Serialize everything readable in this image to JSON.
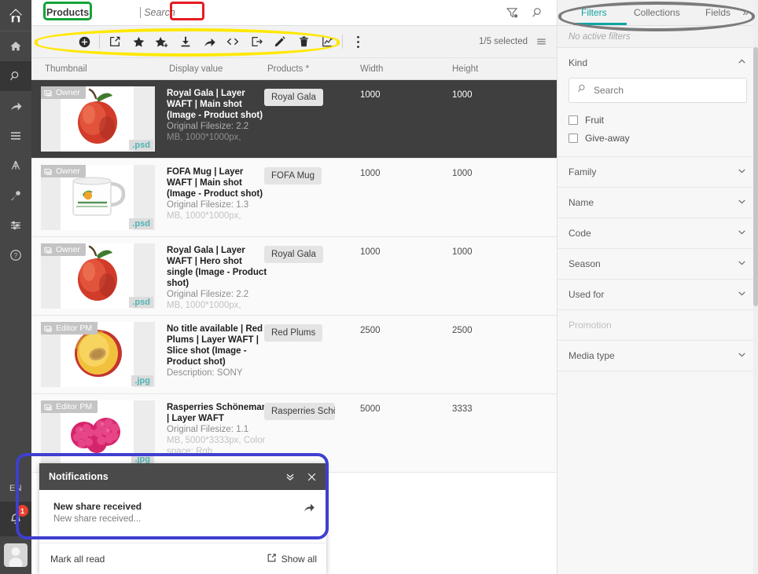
{
  "rail": {
    "logo": "app-logo",
    "items": [
      {
        "name": "home",
        "icon": "home-icon",
        "active": false
      },
      {
        "name": "search",
        "icon": "search-icon",
        "active": true
      },
      {
        "name": "share",
        "icon": "share-arrow-icon",
        "active": false
      },
      {
        "name": "lists",
        "icon": "list-icon",
        "active": false
      },
      {
        "name": "hierarchy",
        "icon": "hierarchy-icon",
        "active": false
      },
      {
        "name": "permissions",
        "icon": "key-icon",
        "active": false
      },
      {
        "name": "settings",
        "icon": "sliders-icon",
        "active": false
      },
      {
        "name": "help",
        "icon": "help-circle-icon",
        "active": false
      }
    ],
    "language": "EN",
    "notification_count": "1"
  },
  "topbar": {
    "breadcrumb": "Products",
    "search_placeholder": "Search",
    "search_value": "",
    "filter_icon": "filter-settings-icon",
    "search_icon": "search-icon"
  },
  "toolbar": {
    "actions": [
      {
        "name": "add",
        "icon": "plus-circle-icon"
      },
      {
        "name": "open-external",
        "icon": "external-link-icon"
      },
      {
        "name": "favorite",
        "icon": "star-icon"
      },
      {
        "name": "add-to-favorites",
        "icon": "star-plus-icon"
      },
      {
        "name": "download",
        "icon": "download-icon"
      },
      {
        "name": "share",
        "icon": "share-arrow-icon"
      },
      {
        "name": "embed-code",
        "icon": "code-brackets-icon"
      },
      {
        "name": "export",
        "icon": "export-box-arrow-icon"
      },
      {
        "name": "edit",
        "icon": "pencil-icon"
      },
      {
        "name": "delete",
        "icon": "trash-icon"
      },
      {
        "name": "statistics",
        "icon": "line-chart-icon"
      },
      {
        "name": "more",
        "icon": "more-vertical-icon"
      }
    ],
    "selected_label": "1/5 selected",
    "view_icon": "list-view-icon"
  },
  "table": {
    "columns": [
      "Thumbnail",
      "Display value",
      "Products *",
      "Width",
      "Height"
    ],
    "rows": [
      {
        "selected": true,
        "badge": "Owner",
        "filetype": ".psd",
        "art": "apple",
        "title": "Royal Gala | Layer WAFT | Main shot (Image - Product shot)",
        "sub": "Original Filesize: 2.2",
        "sub2": "MB, 1000*1000px,",
        "product": "Royal Gala",
        "width": "1000",
        "height": "1000"
      },
      {
        "selected": false,
        "badge": "Owner",
        "filetype": ".psd",
        "art": "mug",
        "title": "FOFA Mug | Layer WAFT | Main shot (Image - Product shot)",
        "sub": "Original Filesize: 1.3",
        "sub2": "MB, 1000*1000px,",
        "product": "FOFA Mug",
        "width": "1000",
        "height": "1000"
      },
      {
        "selected": false,
        "badge": "Owner",
        "filetype": ".psd",
        "art": "apple",
        "title": "Royal Gala | Layer WAFT | Hero shot single (Image - Product shot)",
        "sub": "Original Filesize: 2.2",
        "sub2": "MB, 1000*1000px,",
        "product": "Royal Gala",
        "width": "1000",
        "height": "1000"
      },
      {
        "selected": false,
        "badge": "Editor PM",
        "filetype": ".jpg",
        "art": "plum",
        "title": "No title available | Red Plums | Layer WAFT | Slice shot (Image - Product shot)",
        "sub": "Description: SONY",
        "sub2": "",
        "product": "Red Plums",
        "width": "2500",
        "height": "2500"
      },
      {
        "selected": false,
        "badge": "Editor PM",
        "filetype": ".jpg",
        "art": "raspberry",
        "title": "Rasperries Schöneman | Layer WAFT",
        "sub": "Original Filesize: 1.1",
        "sub2": "MB, 5000*3333px, Color space: Rgb",
        "product": "Rasperries Schöneman",
        "width": "5000",
        "height": "3333"
      }
    ]
  },
  "rightpanel": {
    "tabs": [
      {
        "label": "Filters",
        "active": true
      },
      {
        "label": "Collections",
        "active": false
      },
      {
        "label": "Fields",
        "active": false
      }
    ],
    "expand_icon": "chevron-double-right-icon",
    "no_active_filters": "No active filters",
    "groups": [
      {
        "label": "Kind",
        "expanded": true,
        "disabled": false,
        "search_placeholder": "Search",
        "options": [
          {
            "label": "Fruit",
            "checked": false
          },
          {
            "label": "Give-away",
            "checked": false
          }
        ]
      },
      {
        "label": "Family",
        "expanded": false,
        "disabled": false
      },
      {
        "label": "Name",
        "expanded": false,
        "disabled": false
      },
      {
        "label": "Code",
        "expanded": false,
        "disabled": false
      },
      {
        "label": "Season",
        "expanded": false,
        "disabled": false
      },
      {
        "label": "Used for",
        "expanded": false,
        "disabled": false
      },
      {
        "label": "Promotion",
        "expanded": false,
        "disabled": true
      },
      {
        "label": "Media type",
        "expanded": false,
        "disabled": false
      }
    ]
  },
  "notifications": {
    "title": "Notifications",
    "collapse_icon": "chevron-double-down-icon",
    "close_icon": "close-icon",
    "items": [
      {
        "title": "New share received",
        "subtitle": "New share received...",
        "action_icon": "share-arrow-icon"
      }
    ],
    "mark_all_read": "Mark all read",
    "show_all": "Show all",
    "show_all_icon": "external-link-icon"
  },
  "annotations": {
    "green": "#13a438",
    "red": "#e61b23",
    "yellow": "#ffe800",
    "grey": "#7b7b7b",
    "blue": "#3f3fd0"
  },
  "colors": {
    "accent_teal": "#12a3a3",
    "selected_row": "#3f3f3f",
    "rail_bg": "#464646",
    "badge_red": "#e8402a"
  }
}
